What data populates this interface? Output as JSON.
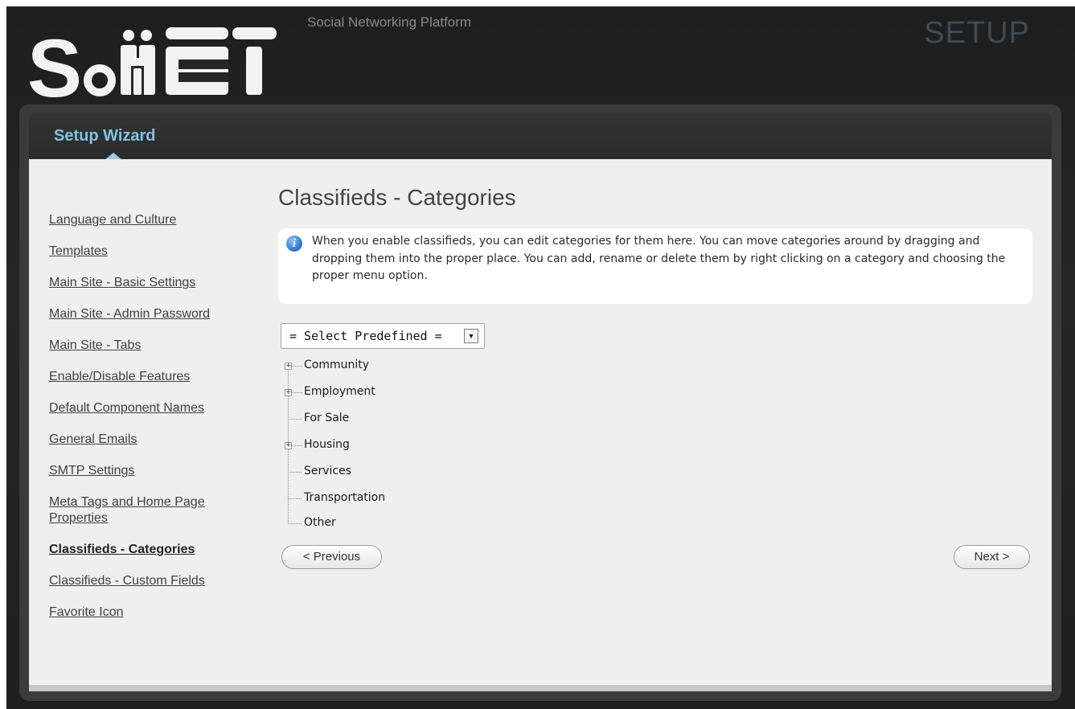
{
  "header": {
    "logo_text": "SocNET",
    "tagline": "Social Networking Platform",
    "mode_label": "SETUP"
  },
  "wizard": {
    "title": "Setup Wizard"
  },
  "sidebar": {
    "items": [
      {
        "label": "Language and Culture"
      },
      {
        "label": "Templates"
      },
      {
        "label": "Main Site - Basic Settings"
      },
      {
        "label": "Main Site - Admin Password"
      },
      {
        "label": "Main Site - Tabs"
      },
      {
        "label": "Enable/Disable Features"
      },
      {
        "label": "Default Component Names"
      },
      {
        "label": "General Emails"
      },
      {
        "label": "SMTP Settings"
      },
      {
        "label": "Meta Tags and Home Page Properties"
      },
      {
        "label": "Classifieds - Categories",
        "active": true
      },
      {
        "label": "Classifieds - Custom Fields"
      },
      {
        "label": "Favorite Icon"
      }
    ]
  },
  "main": {
    "title": "Classifieds - Categories",
    "info_icon": "info-icon",
    "info_text": "When you enable classifieds, you can edit categories for them here. You can move categories around by dragging and dropping them into the proper place. You can add, rename or delete them by right clicking on a category and choosing the proper menu option.",
    "predefined_select": {
      "value": "= Select Predefined ="
    },
    "categories": [
      {
        "label": "Community",
        "expandable": true
      },
      {
        "label": "Employment",
        "expandable": true
      },
      {
        "label": "For Sale",
        "expandable": false
      },
      {
        "label": "Housing",
        "expandable": true
      },
      {
        "label": "Services",
        "expandable": false
      },
      {
        "label": "Transportation",
        "expandable": false
      },
      {
        "label": "Other",
        "expandable": false
      }
    ],
    "previous_label": "< Previous",
    "next_label": "Next >"
  },
  "colors": {
    "accent": "#7ec3e6",
    "background_dark": "#222222",
    "content_bg": "#efefef"
  }
}
